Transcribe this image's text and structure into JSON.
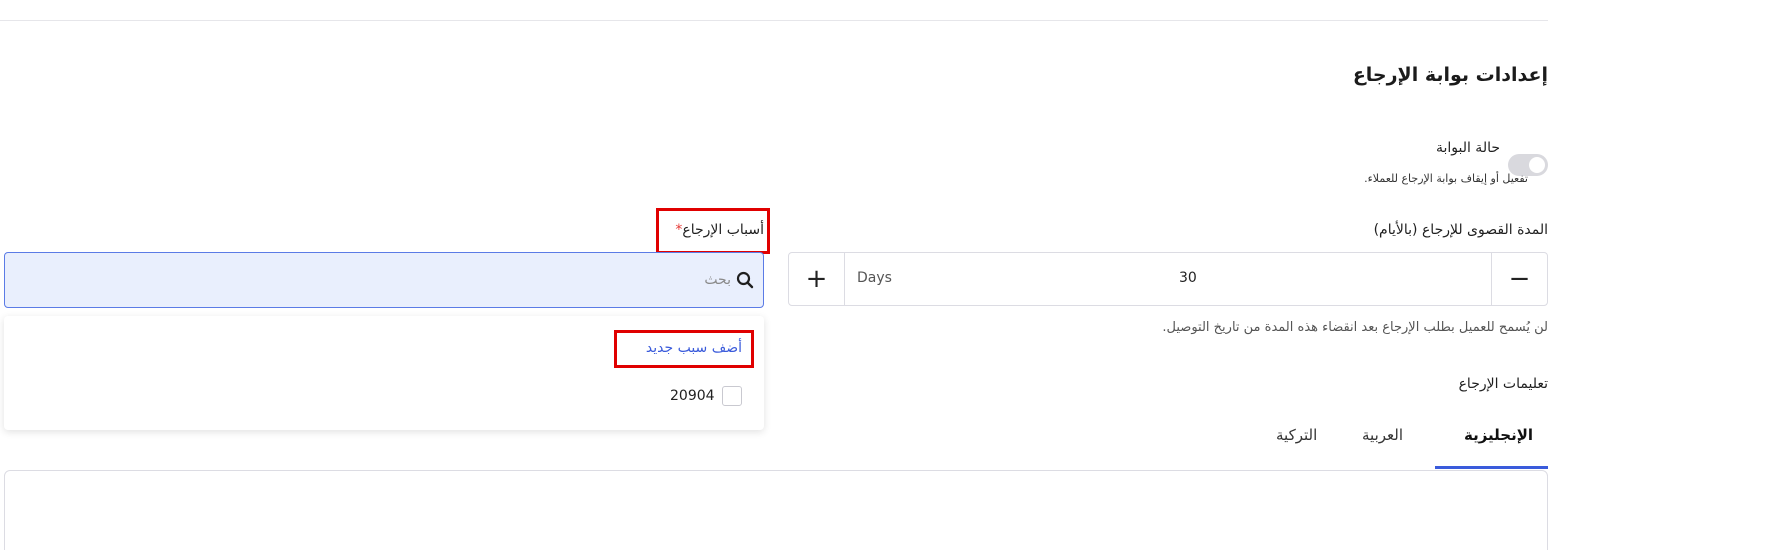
{
  "section": {
    "title": "إعدادات بوابة الإرجاع"
  },
  "portal_status": {
    "title": "حالة البوابة",
    "description": "تفعيل أو إيقاف بوابة الإرجاع للعملاء.",
    "enabled": false
  },
  "max_days": {
    "label": "المدة القصوى للإرجاع (بالأيام)",
    "value": "30",
    "unit": "Days",
    "help": "لن يُسمح للعميل بطلب الإرجاع بعد انقضاء هذه المدة من تاريخ التوصيل.",
    "plus": "+",
    "minus": "−"
  },
  "instructions": {
    "label": "تعليمات الإرجاع",
    "tabs": [
      {
        "label": "الإنجليزية",
        "active": true
      },
      {
        "label": "العربية",
        "active": false
      },
      {
        "label": "التركية",
        "active": false
      }
    ]
  },
  "return_reasons": {
    "label": "أسباب الإرجاع",
    "required_mark": "*",
    "search_placeholder": "بحث",
    "add_new_label": "أضف سبب جديد",
    "options": [
      {
        "label": "20904",
        "checked": false
      }
    ]
  },
  "colors": {
    "accent": "#3a5bdb",
    "highlight": "#e00000",
    "search_bg": "#e9effd"
  },
  "icons": {
    "search": "search-icon"
  }
}
